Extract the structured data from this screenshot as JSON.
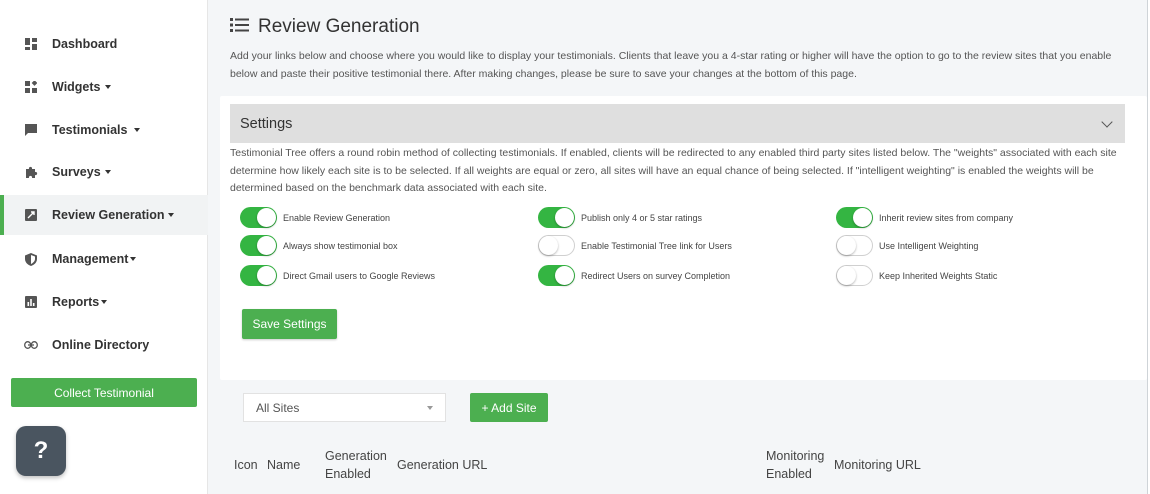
{
  "sidebar": {
    "items": [
      {
        "label": "Dashboard",
        "icon": "dashboard-icon",
        "dropdown": false
      },
      {
        "label": "Widgets",
        "icon": "widgets-icon",
        "dropdown": true
      },
      {
        "label": "Testimonials",
        "icon": "chat-icon",
        "dropdown": true
      },
      {
        "label": "Surveys",
        "icon": "puzzle-icon",
        "dropdown": true
      },
      {
        "label": "Review Generation",
        "icon": "review-icon",
        "dropdown": true,
        "active": true
      },
      {
        "label": "Management",
        "icon": "shield-icon",
        "dropdown": true
      },
      {
        "label": "Reports",
        "icon": "chart-icon",
        "dropdown": true
      },
      {
        "label": "Online Directory",
        "icon": "link-icon",
        "dropdown": false
      }
    ],
    "collect_button": "Collect Testimonial",
    "help_button": "?"
  },
  "page": {
    "title": "Review Generation",
    "intro": "Add your links below and choose where you would like to display your testimonials. Clients that leave you a 4-star rating or higher will have the option to go to the review sites that you enable below and paste their positive testimonial there. After making changes, please be sure to save your changes at the bottom of this page."
  },
  "settings": {
    "title": "Settings",
    "description": "Testimonial Tree offers a round robin method of collecting testimonials. If enabled, clients will be redirected to any enabled third party sites listed below. The \"weights\" associated with each site determine how likely each site is to be selected. If all weights are equal or zero, all sites will have an equal chance of being selected. If \"intelligent weighting\" is enabled the weights will be determined based on the benchmark data associated with each site.",
    "toggles": [
      {
        "label": "Enable Review Generation",
        "on": true
      },
      {
        "label": "Publish only 4 or 5 star ratings",
        "on": true
      },
      {
        "label": "Inherit review sites from company",
        "on": true
      },
      {
        "label": "Always show testimonial box",
        "on": true
      },
      {
        "label": "Enable Testimonial Tree link for Users",
        "on": false
      },
      {
        "label": "Use Intelligent Weighting",
        "on": false
      },
      {
        "label": "Direct Gmail users to Google Reviews",
        "on": true
      },
      {
        "label": "Redirect Users on survey Completion",
        "on": true
      },
      {
        "label": "Keep Inherited Weights Static",
        "on": false
      }
    ],
    "save_button": "Save Settings"
  },
  "sites": {
    "filter_value": "All Sites",
    "add_button": "+ Add Site",
    "columns": [
      "Icon",
      "Name",
      "Generation Enabled",
      "Generation URL",
      "Monitoring Enabled",
      "Monitoring URL"
    ]
  },
  "colors": {
    "accent": "#4caf50",
    "toggle_on": "#34b542"
  }
}
